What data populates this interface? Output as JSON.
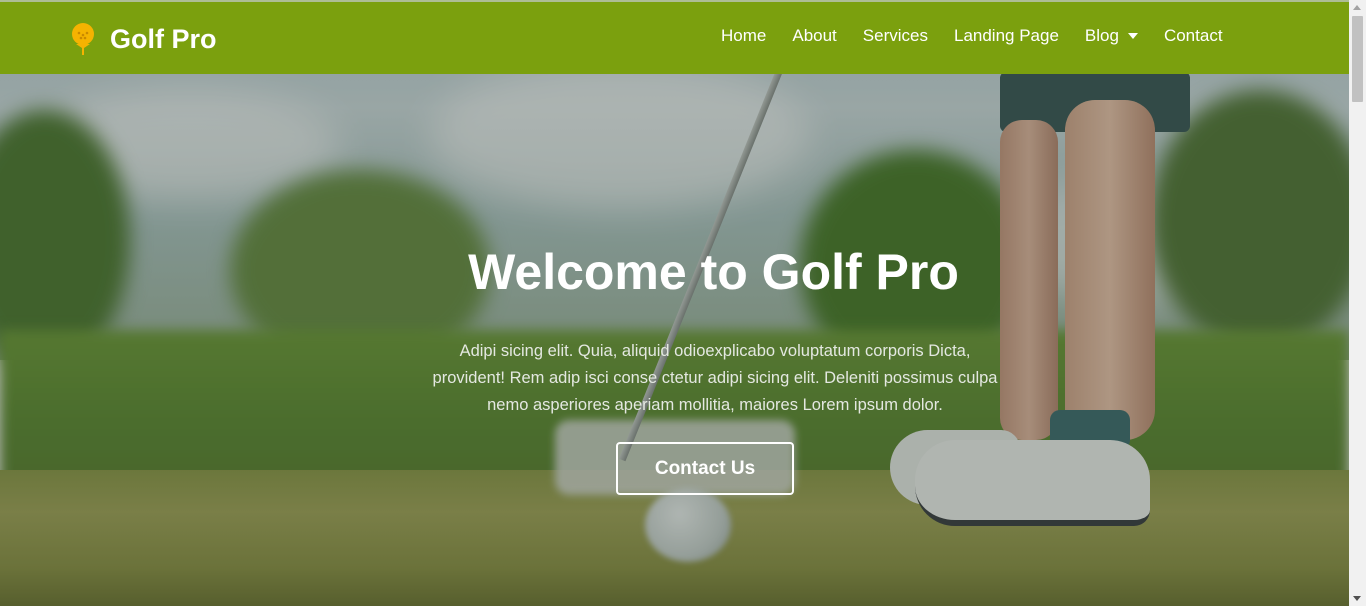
{
  "brand": {
    "name": "Golf Pro",
    "icon": "golf-ball-on-tee-icon",
    "icon_color": "#f5b301"
  },
  "nav": {
    "items": [
      {
        "label": "Home"
      },
      {
        "label": "About"
      },
      {
        "label": "Services"
      },
      {
        "label": "Landing Page"
      },
      {
        "label": "Blog",
        "has_dropdown": true
      },
      {
        "label": "Contact"
      }
    ]
  },
  "hero": {
    "title": "Welcome to Golf Pro",
    "text": "Adipi sicing elit. Quia, aliquid odioexplicabo voluptatum corporis Dicta, provident! Rem adip isci conse ctetur adipi sicing elit. Deleniti possimus culpa nemo asperiores aperiam mollitia, maiores Lorem ipsum dolor.",
    "cta_label": "Contact Us"
  },
  "colors": {
    "navbar": "#7ba00e",
    "text": "#ffffff"
  }
}
